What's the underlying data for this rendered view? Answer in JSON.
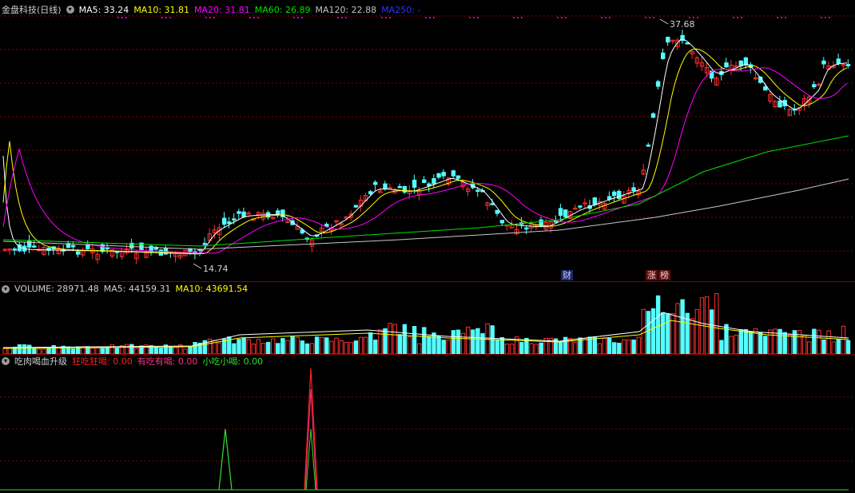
{
  "price_pane": {
    "title": "金盘科技(日线)",
    "ma": [
      {
        "label": "MA5: 33.24",
        "color": "#ffffff"
      },
      {
        "label": "MA10: 31.81",
        "color": "#ffff00"
      },
      {
        "label": "MA20: 31.81",
        "color": "#ff00ff"
      },
      {
        "label": "MA60: 26.89",
        "color": "#00e000"
      },
      {
        "label": "MA120: 22.88",
        "color": "#c0c0c0"
      },
      {
        "label": "MA250: -",
        "color": "#3030ff"
      }
    ],
    "high_label": "37.68",
    "low_label": "14.74",
    "tag_cai": "财",
    "tag_zhang": "涨",
    "tag_bang": "榜"
  },
  "volume_pane": {
    "labels": [
      {
        "label": "VOLUME: 28971.48",
        "color": "#d0d0d0"
      },
      {
        "label": "MA5: 44159.31",
        "color": "#d0d0d0"
      },
      {
        "label": "MA10: 43691.54",
        "color": "#ffff00"
      }
    ]
  },
  "indicator_pane": {
    "title": "吃肉喝血升级",
    "labels": [
      {
        "label": "狂吃狂喝: 0.00",
        "color": "#ff2020"
      },
      {
        "label": "有吃有喝: 0.00",
        "color": "#ff3080"
      },
      {
        "label": "小吃小喝: 0.00",
        "color": "#30e030"
      }
    ]
  },
  "colors": {
    "up": "#ff3030",
    "down": "#54ffff",
    "grid": "#8b0000"
  }
}
